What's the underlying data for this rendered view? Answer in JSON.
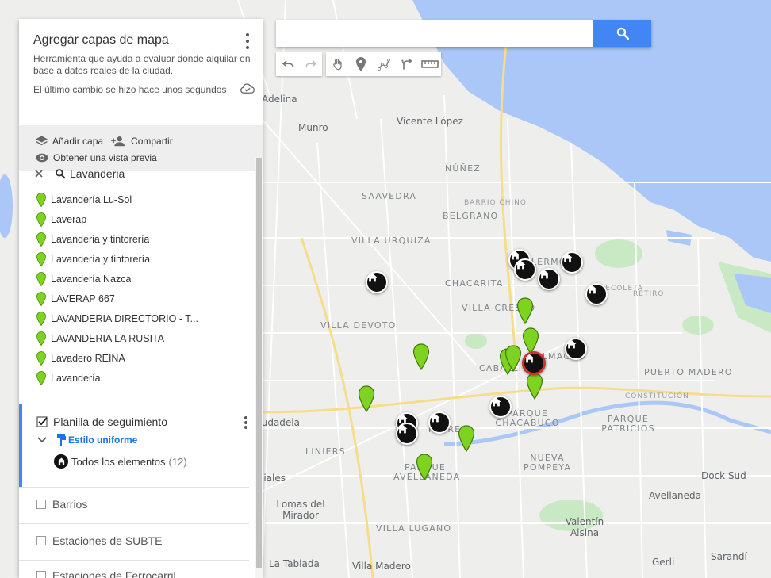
{
  "map": {
    "labels": [
      {
        "text": "Adelina",
        "kind": "big"
      },
      {
        "text": "Munro",
        "kind": "big"
      },
      {
        "text": "Vicente López",
        "kind": "big"
      },
      {
        "text": "NÚÑEZ",
        "kind": "hood"
      },
      {
        "text": "SAAVEDRA",
        "kind": "hood"
      },
      {
        "text": "BARRIO CHINO",
        "kind": "small"
      },
      {
        "text": "BELGRANO",
        "kind": "hood"
      },
      {
        "text": "VILLA URQUIZA",
        "kind": "hood"
      },
      {
        "text": "PALERMO",
        "kind": "hood"
      },
      {
        "text": "CHACARITA",
        "kind": "hood"
      },
      {
        "text": "VILLA CRESPO",
        "kind": "hood"
      },
      {
        "text": "RECOLETA",
        "kind": "small"
      },
      {
        "text": "RETIRO",
        "kind": "small"
      },
      {
        "text": "VILLA DEVOTO",
        "kind": "hood"
      },
      {
        "text": "ALMAGRO",
        "kind": "hood"
      },
      {
        "text": "CABALLITO",
        "kind": "hood"
      },
      {
        "text": "PUERTO MADERO",
        "kind": "hood"
      },
      {
        "text": "CONSTITUCIÓN",
        "kind": "small"
      },
      {
        "text": "Ciudadela",
        "kind": "big"
      },
      {
        "text": "PARQUE CHACABUCO",
        "kind": "hood"
      },
      {
        "text": "PARQUE PATRICIOS",
        "kind": "hood"
      },
      {
        "text": "FLORES",
        "kind": "hood"
      },
      {
        "text": "LINIERS",
        "kind": "hood"
      },
      {
        "text": "NUEVA POMPEYA",
        "kind": "hood"
      },
      {
        "text": "PARQUE AVELLANEDA",
        "kind": "hood"
      },
      {
        "text": "Dock Sud",
        "kind": "big"
      },
      {
        "text": "Avellaneda",
        "kind": "big"
      },
      {
        "text": "Tapiales",
        "kind": "big"
      },
      {
        "text": "Lomas del Mirador",
        "kind": "big"
      },
      {
        "text": "VILLA LUGANO",
        "kind": "hood"
      },
      {
        "text": "Valentín Alsina",
        "kind": "big"
      },
      {
        "text": "Gerli",
        "kind": "big"
      },
      {
        "text": "Sarandí",
        "kind": "big"
      },
      {
        "text": "La Tablada",
        "kind": "big"
      },
      {
        "text": "Villa Madero",
        "kind": "big"
      }
    ],
    "colors": {
      "land": "#eeeeec",
      "water": "#aac7f7",
      "park": "#c9e8c4",
      "road": "#ffffff",
      "pin": "#7ed321",
      "home": "#111111",
      "selected": "#d93025"
    }
  },
  "search": {
    "value": "",
    "placeholder": "",
    "button_icon": "search-icon"
  },
  "toolbar": [
    "undo-icon",
    "redo-icon",
    "hand-icon",
    "marker-icon",
    "line-icon",
    "directions-icon",
    "ruler-icon"
  ],
  "panel": {
    "title": "Agregar capas de mapa",
    "description": "Herramienta que ayuda a evaluar dónde alquilar en base a datos reales de la ciudad.",
    "saved": "El último cambio se hizo hace unos segundos",
    "actions": {
      "add_layer": "Añadir capa",
      "share": "Compartir",
      "preview": "Obtener una vista previa"
    }
  },
  "search_layer": {
    "query": "Lavanderia",
    "results": [
      "Lavandería Lu-Sol",
      "Laverap",
      "Lavanderia y tintorería",
      "Lavandería y tintorería",
      "Lavandería Nazca",
      "LAVERAP 667",
      "LAVANDERIA DIRECTORIO - T...",
      "LAVANDERIA LA RUSITA",
      "Lavadero REINA",
      "Lavandería"
    ]
  },
  "layer": {
    "name": "Planilla de seguimiento",
    "style": "Estilo uniforme",
    "all_items": "Todos los elementos",
    "count": "(12)"
  },
  "other_layers": [
    "Barrios",
    "Estaciones de SUBTE",
    "Estaciones de Ferrocarril"
  ]
}
